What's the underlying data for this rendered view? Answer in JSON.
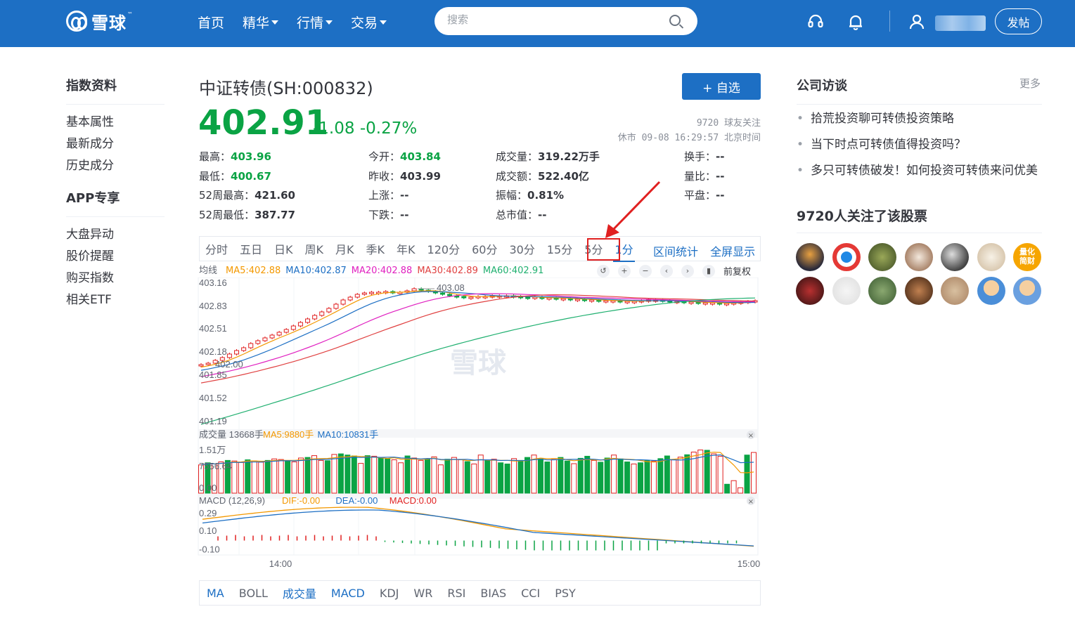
{
  "header": {
    "logo_text": "雪球",
    "logo_tm": "™",
    "nav": [
      {
        "label": "首页",
        "dropdown": false
      },
      {
        "label": "精华",
        "dropdown": true
      },
      {
        "label": "行情",
        "dropdown": true
      },
      {
        "label": "交易",
        "dropdown": true
      }
    ],
    "search_placeholder": "搜索",
    "post_label": "发帖",
    "accent": "#1d6fc4"
  },
  "leftnav": {
    "section1_title": "指数资料",
    "section1_items": [
      "基本属性",
      "最新成分",
      "历史成分"
    ],
    "section2_title": "APP专享",
    "section2_items": [
      "大盘异动",
      "股价提醒",
      "购买指数",
      "相关ETF"
    ]
  },
  "stock": {
    "title": "中证转债(SH:000832)",
    "add_label": "+ 自选",
    "price": "402.91",
    "change": "-1.08 -0.27%",
    "followers": "9720 球友关注",
    "status": "休市 09-08 16:29:57 北京时间",
    "quote": [
      {
        "label": "最高：",
        "value": "403.96",
        "green": true
      },
      {
        "label": "今开：",
        "value": "403.84",
        "green": true
      },
      {
        "label": "成交量：",
        "value": "319.22万手",
        "green": false
      },
      {
        "label": "换手：",
        "value": "--",
        "green": false
      },
      {
        "label": "最低：",
        "value": "400.67",
        "green": true
      },
      {
        "label": "昨收：",
        "value": "403.99",
        "green": false
      },
      {
        "label": "成交额：",
        "value": "522.40亿",
        "green": false
      },
      {
        "label": "量比：",
        "value": "--",
        "green": false
      },
      {
        "label": "52周最高：",
        "value": "421.60",
        "green": false
      },
      {
        "label": "上涨：",
        "value": "--",
        "green": false
      },
      {
        "label": "振幅：",
        "value": "0.81%",
        "green": false
      },
      {
        "label": "平盘：",
        "value": "--",
        "green": false
      },
      {
        "label": "52周最低：",
        "value": "387.77",
        "green": false
      },
      {
        "label": "下跌：",
        "value": "--",
        "green": false
      },
      {
        "label": "总市值：",
        "value": "--",
        "green": false
      }
    ]
  },
  "chart_tabs": [
    "分时",
    "五日",
    "日K",
    "周K",
    "月K",
    "季K",
    "年K",
    "120分",
    "60分",
    "30分",
    "15分",
    "5分",
    "1分"
  ],
  "active_tab": "1分",
  "chart_tools": [
    "区间统计",
    "全屏显示"
  ],
  "adjust_label": "前复权",
  "ma_legend": {
    "label": "均线",
    "items": [
      {
        "text": "MA5:402.88",
        "color": "#f39800"
      },
      {
        "text": "MA10:402.87",
        "color": "#1d6fc4"
      },
      {
        "text": "MA20:402.88",
        "color": "#e020c0"
      },
      {
        "text": "MA30:402.89",
        "color": "#e04040"
      },
      {
        "text": "MA60:402.91",
        "color": "#20b070"
      }
    ]
  },
  "volume_legend": {
    "label": "成交量 13668手",
    "items": [
      {
        "text": "MA5:9880手",
        "color": "#f39800"
      },
      {
        "text": "MA10:10831手",
        "color": "#1d6fc4"
      }
    ]
  },
  "macd_legend": {
    "label": "MACD (12,26,9)",
    "items": [
      {
        "text": "DIF:-0.00",
        "color": "#f39800"
      },
      {
        "text": "DEA:-0.00",
        "color": "#1d6fc4"
      },
      {
        "text": "MACD:0.00",
        "color": "#e02020"
      }
    ]
  },
  "watermark": "雪球",
  "indicator_tabs": [
    {
      "label": "MA",
      "blue": true
    },
    {
      "label": "BOLL",
      "blue": false
    },
    {
      "label": "成交量",
      "blue": true
    },
    {
      "label": "MACD",
      "blue": true
    },
    {
      "label": "KDJ",
      "blue": false
    },
    {
      "label": "WR",
      "blue": false
    },
    {
      "label": "RSI",
      "blue": false
    },
    {
      "label": "BIAS",
      "blue": false
    },
    {
      "label": "CCI",
      "blue": false
    },
    {
      "label": "PSY",
      "blue": false
    }
  ],
  "right": {
    "interview_title": "公司访谈",
    "more": "更多",
    "interviews": [
      "拾荒投资聊可转债投资策略",
      "当下时点可转债值得投资吗？",
      "多只可转债破发！如何投资可转债来问优美"
    ],
    "followers_title": "9720人关注了该股票",
    "avatar_badge": "量化\n简财"
  },
  "chart_data": [
    {
      "type": "candlestick",
      "title": "",
      "x_ticks": [
        "14:00",
        "15:00"
      ],
      "y_ticks": [
        403.16,
        402.83,
        402.51,
        402.18,
        401.85,
        401.52,
        401.19
      ],
      "ylim": [
        401.19,
        403.16
      ],
      "annotations": [
        "403.08",
        "402.00"
      ],
      "close_series": [
        402.0,
        402.02,
        402.06,
        402.1,
        402.15,
        402.2,
        402.24,
        402.3,
        402.34,
        402.38,
        402.42,
        402.46,
        402.5,
        402.55,
        402.6,
        402.65,
        402.7,
        402.75,
        402.8,
        402.86,
        402.92,
        402.96,
        403.0,
        403.02,
        403.03,
        403.03,
        403.04,
        403.02,
        403.03,
        403.05,
        403.08,
        403.06,
        403.04,
        403.02,
        403.0,
        402.98,
        402.97,
        402.96,
        402.96,
        402.97,
        402.97,
        402.98,
        402.98,
        402.98,
        402.97,
        402.96,
        402.95,
        402.96,
        402.95,
        402.95,
        402.94,
        402.94,
        402.93,
        402.93,
        402.92,
        402.92,
        402.91,
        402.91,
        402.91,
        402.9,
        402.9,
        402.9,
        402.91,
        402.92,
        402.92,
        402.91,
        402.9,
        402.9,
        402.89,
        402.89,
        402.88,
        402.88,
        402.88,
        402.87,
        402.87,
        402.88,
        402.89,
        402.9,
        402.91
      ],
      "ma_final": {
        "MA5": 402.88,
        "MA10": 402.87,
        "MA20": 402.88,
        "MA30": 402.89,
        "MA60": 402.91
      }
    },
    {
      "type": "bar",
      "title": "成交量 13668手",
      "y_ticks": [
        "1.51万",
        "7556.64",
        "0.00"
      ],
      "ylim": [
        0,
        15100
      ],
      "values": [
        9500,
        10200,
        9800,
        10500,
        11000,
        10800,
        10300,
        11200,
        10800,
        10400,
        11000,
        11500,
        11300,
        10800,
        10500,
        11800,
        12000,
        12600,
        11000,
        10900,
        13000,
        13200,
        12800,
        12500,
        10000,
        12600,
        12400,
        11800,
        11500,
        11200,
        10200,
        12500,
        11800,
        11000,
        11500,
        12200,
        9500,
        11400,
        12000,
        11200,
        10600,
        9800,
        12800,
        10900,
        11400,
        10200,
        9800,
        11600,
        11000,
        12000,
        12800,
        11500,
        10500,
        11300,
        12000,
        10800,
        9900,
        11700,
        12400,
        11000,
        10400,
        11800,
        12800,
        11500,
        10500,
        9800,
        10200,
        11000,
        10700,
        11600,
        12500,
        11200,
        12100,
        12900,
        13800,
        14500,
        14400,
        13200,
        12400,
        3000,
        4200,
        1800,
        12800,
        13668
      ],
      "colors_note": "red hollow = up, green solid = down"
    },
    {
      "type": "line",
      "title": "MACD (12,26,9)",
      "y_ticks": [
        0.29,
        0.1,
        -0.1
      ],
      "ylim": [
        -0.12,
        0.32
      ]
    }
  ]
}
